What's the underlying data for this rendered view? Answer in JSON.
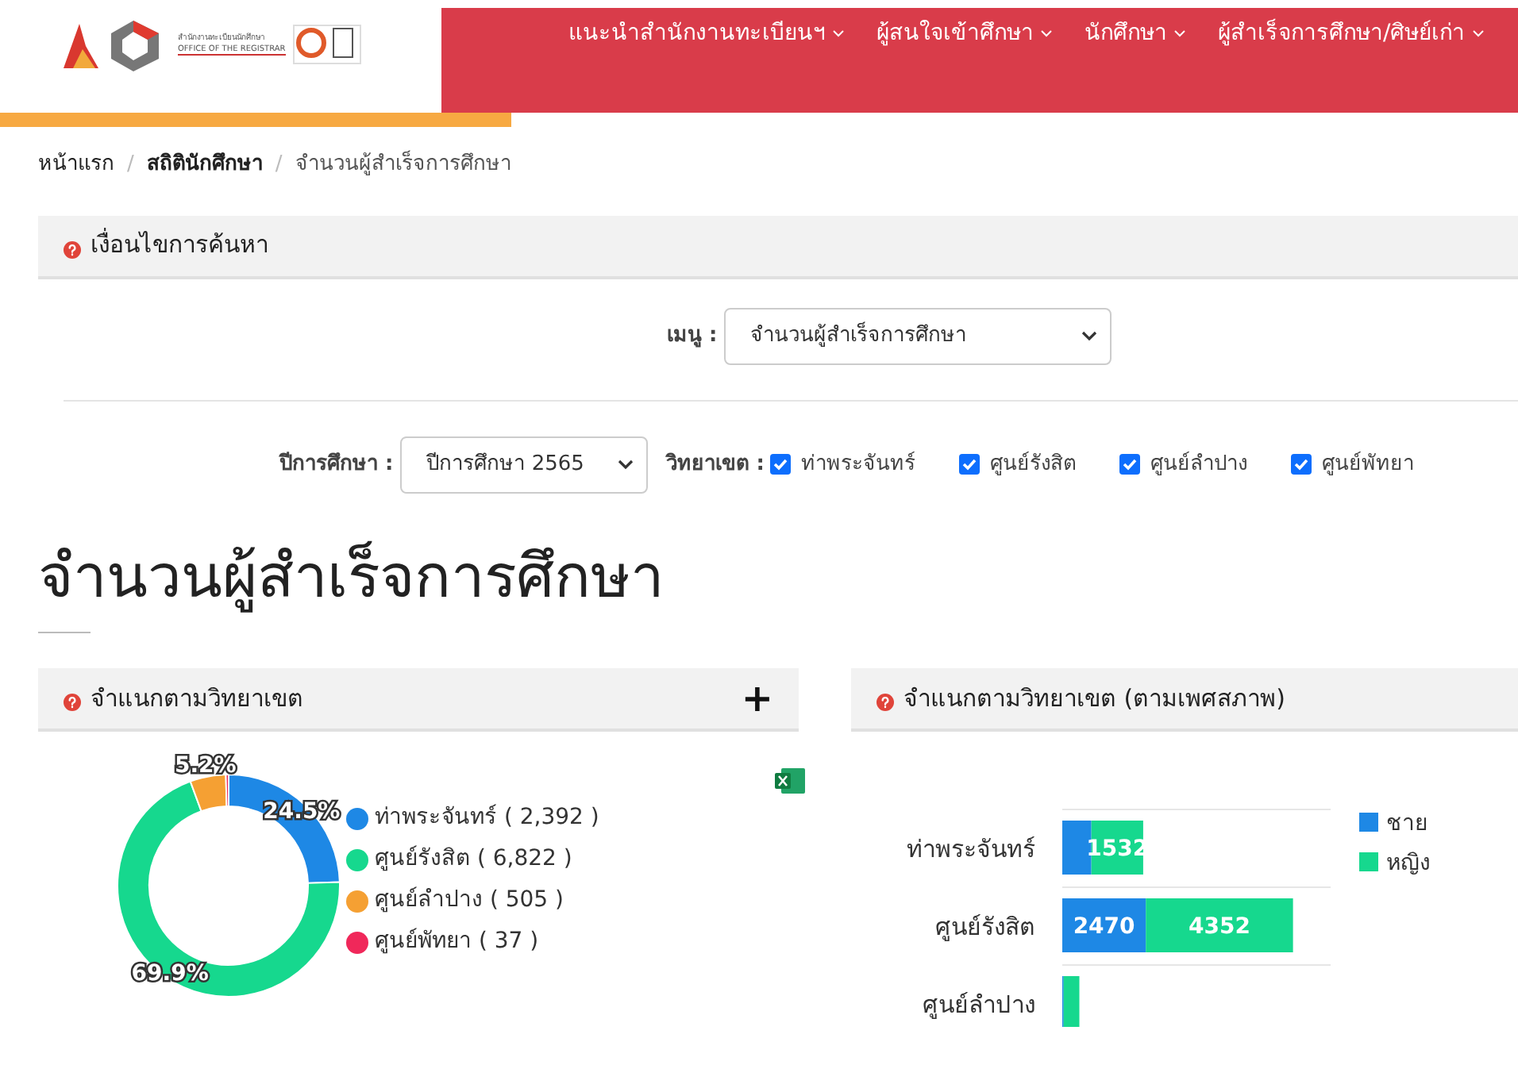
{
  "header": {
    "logo_text_th": "สำนักงานทะเบียนนักศึกษา",
    "logo_text_en": "OFFICE OF THE REGISTRAR",
    "nav": [
      {
        "label": "แนะนำสำนักงานทะเบียนฯ"
      },
      {
        "label": "ผู้สนใจเข้าศึกษา"
      },
      {
        "label": "นักศึกษา"
      },
      {
        "label": "ผู้สำเร็จการศึกษา/ศิษย์เก่า"
      }
    ]
  },
  "breadcrumb_separator": "/",
  "breadcrumb": [
    {
      "label": "หน้าแรก",
      "current": false
    },
    {
      "label": "สถิตินักศึกษา",
      "current": false
    },
    {
      "label": "จำนวนผู้สำเร็จการศึกษา",
      "current": true
    }
  ],
  "search_panel": {
    "title": "เงื่อนไขการค้นหา",
    "menu_label": "เมนู :",
    "menu_value": "จำนวนผู้สำเร็จการศึกษา",
    "year_label": "ปีการศึกษา :",
    "year_value": "ปีการศึกษา 2565",
    "campus_label": "วิทยาเขต :",
    "campuses": [
      {
        "label": "ท่าพระจันทร์",
        "checked": true
      },
      {
        "label": "ศูนย์รังสิต",
        "checked": true
      },
      {
        "label": "ศูนย์ลำปาง",
        "checked": true
      },
      {
        "label": "ศูนย์พัทยา",
        "checked": true
      }
    ]
  },
  "page_title": "จำนวนผู้สำเร็จการศึกษา",
  "panels": [
    {
      "title": "จำแนกตามวิทยาเขต",
      "expand_symbol": "+",
      "legend_counts": [
        "( 2,392 )",
        "( 6,822 )",
        "( 505 )",
        "( 37 )"
      ],
      "chart_data": {
        "type": "donut",
        "categories": [
          "ท่าพระจันทร์",
          "ศูนย์รังสิต",
          "ศูนย์ลำปาง",
          "ศูนย์พัทยา"
        ],
        "values": [
          24.5,
          69.9,
          5.2,
          0.4
        ],
        "colors": [
          "#1e88e5",
          "#16d88e",
          "#f5a033",
          "#f0285a"
        ],
        "value_labels": [
          "24.5%",
          "69.9%",
          "5.2%",
          null
        ]
      }
    },
    {
      "title": "จำแนกตามวิทยาเขต (ตามเพศสภาพ)",
      "chart_data": {
        "type": "bar",
        "orientation": "horizontal",
        "stacked": true,
        "categories": [
          "ท่าพระจันทร์",
          "ศูนย์รังสิต",
          "ศูนย์ลำปาง"
        ],
        "series": [
          {
            "name": "ชาย",
            "color": "#1e88e5",
            "values": [
              860,
              2470,
              40
            ],
            "value_labels": [
              null,
              "2470",
              null
            ]
          },
          {
            "name": "หญิง",
            "color": "#16d88e",
            "values": [
              1532,
              4352,
              465
            ],
            "value_labels": [
              "1532",
              "4352",
              null
            ]
          }
        ],
        "legend": true
      }
    }
  ]
}
